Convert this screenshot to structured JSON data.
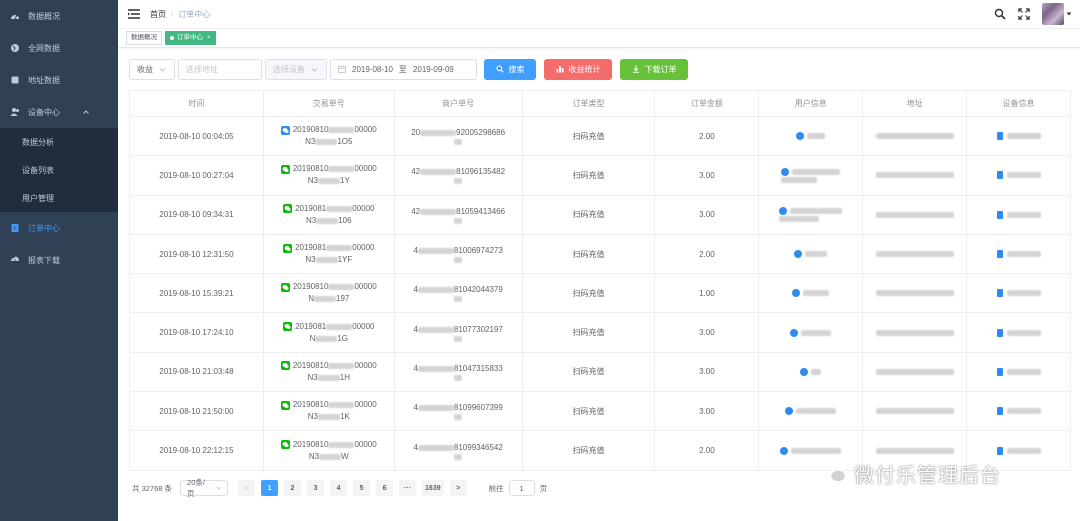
{
  "sidebar": {
    "items": [
      {
        "label": "数据概况",
        "icon": "dashboard-icon"
      },
      {
        "label": "全网数据",
        "icon": "globe-icon"
      },
      {
        "label": "地址数据",
        "icon": "location-icon"
      },
      {
        "label": "设备中心",
        "icon": "users-icon"
      }
    ],
    "submenu": [
      "数据分析",
      "设备列表",
      "用户管理"
    ],
    "after": [
      {
        "label": "订单中心",
        "icon": "order-icon",
        "active": true
      },
      {
        "label": "报表下载",
        "icon": "download-icon"
      }
    ]
  },
  "header": {
    "breadcrumb_home": "首页",
    "breadcrumb_sep": "/",
    "breadcrumb_current": "订单中心"
  },
  "tags": [
    {
      "label": "数据概况",
      "active": false
    },
    {
      "label": "订单中心",
      "active": true,
      "close": "×"
    }
  ],
  "filters": {
    "type_select": "收益",
    "address_placeholder": "选择地址",
    "device_placeholder": "选择设备",
    "date_start": "2019-08-10",
    "date_to": "至",
    "date_end": "2019-09-09",
    "search_label": "搜索",
    "stats_label": "收益统计",
    "download_label": "下载订单"
  },
  "table": {
    "columns": [
      "时间",
      "交易单号",
      "商户单号",
      "订单类型",
      "订单金额",
      "用户信息",
      "地址",
      "设备信息"
    ],
    "rows": [
      {
        "time": "2019-08-10 00:04:05",
        "trade_a": "20190810",
        "trade_b": "00000",
        "trade_c": "N3",
        "trade_d": "1O5",
        "merch_a": "20",
        "merch_b": "92005298686",
        "type": "扫码充值",
        "amount": "2.00",
        "pay": "alipay"
      },
      {
        "time": "2019-08-10 00:27:04",
        "trade_a": "20190810",
        "trade_b": "00000",
        "trade_c": "N3",
        "trade_d": "1Y",
        "merch_a": "42",
        "merch_b": "81096135482",
        "type": "扫码充值",
        "amount": "3.00",
        "pay": "wechat"
      },
      {
        "time": "2019-08-10 09:34:31",
        "trade_a": "2019081",
        "trade_b": "00000",
        "trade_c": "N3",
        "trade_d": "106",
        "merch_a": "42",
        "merch_b": "81059413466",
        "type": "扫码充值",
        "amount": "3.00",
        "pay": "wechat"
      },
      {
        "time": "2019-08-10 12:31:50",
        "trade_a": "2019081",
        "trade_b": "00000",
        "trade_c": "N3",
        "trade_d": "1YF",
        "merch_a": "4",
        "merch_b": "81006974273",
        "type": "扫码充值",
        "amount": "2.00",
        "pay": "wechat"
      },
      {
        "time": "2019-08-10 15:39:21",
        "trade_a": "20190810",
        "trade_b": "00000",
        "trade_c": "N",
        "trade_d": "197",
        "merch_a": "4",
        "merch_b": "81042044379",
        "type": "扫码充值",
        "amount": "1.00",
        "pay": "wechat"
      },
      {
        "time": "2019-08-10 17:24:10",
        "trade_a": "2019081",
        "trade_b": "00000",
        "trade_c": "N",
        "trade_d": "1G",
        "merch_a": "4",
        "merch_b": "81077302197",
        "type": "扫码充值",
        "amount": "3.00",
        "pay": "wechat"
      },
      {
        "time": "2019-08-10 21:03:48",
        "trade_a": "20190810",
        "trade_b": "00000",
        "trade_c": "N3",
        "trade_d": "1H",
        "merch_a": "4",
        "merch_b": "81047315833",
        "type": "扫码充值",
        "amount": "3.00",
        "pay": "wechat"
      },
      {
        "time": "2019-08-10 21:50:00",
        "trade_a": "20190810",
        "trade_b": "00000",
        "trade_c": "N3",
        "trade_d": "1K",
        "merch_a": "4",
        "merch_b": "81099607399",
        "type": "扫码充值",
        "amount": "3.00",
        "pay": "wechat"
      },
      {
        "time": "2019-08-10 22:12:15",
        "trade_a": "20190810",
        "trade_b": "00000",
        "trade_c": "N3",
        "trade_d": "W",
        "merch_a": "4",
        "merch_b": "81099346542",
        "type": "扫码充值",
        "amount": "2.00",
        "pay": "wechat"
      }
    ]
  },
  "pagination": {
    "total": "共 32768 条",
    "page_size": "20条/页",
    "prev": "<",
    "pages": [
      "1",
      "2",
      "3",
      "4",
      "5",
      "6",
      "···",
      "1639"
    ],
    "next": ">",
    "goto_label": "前往",
    "goto_value": "1",
    "goto_suffix": "页"
  },
  "watermark": "微付乐管理后台",
  "colors": {
    "sidebar_bg": "#304156",
    "accent": "#409eff",
    "tag_active": "#42b983",
    "danger": "#f56c6c",
    "success": "#67c23a"
  }
}
